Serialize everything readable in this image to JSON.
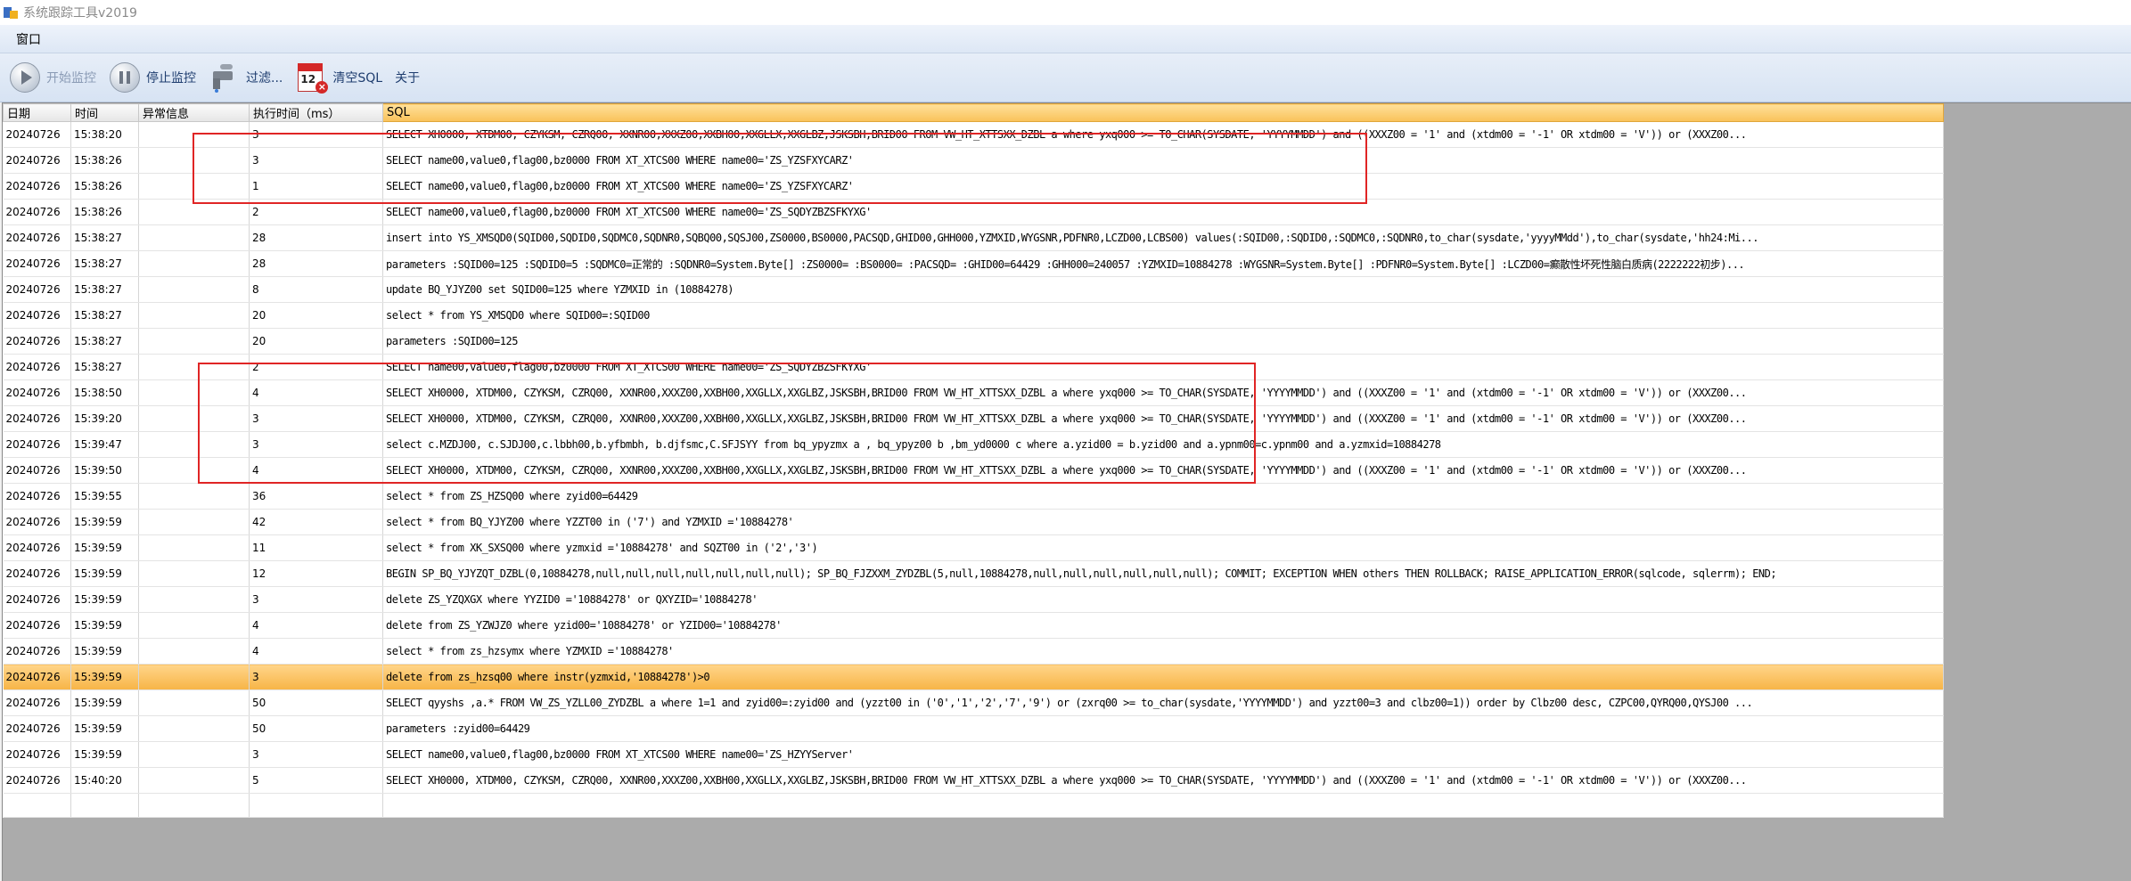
{
  "window": {
    "title": "系统跟踪工具v2019"
  },
  "menu": {
    "items": [
      "窗口"
    ]
  },
  "toolbar": {
    "start": "开始监控",
    "stop": "停止监控",
    "filter": "过滤...",
    "clear_sql": "清空SQL",
    "about": "关于"
  },
  "columns": [
    "日期",
    "时间",
    "异常信息",
    "执行时间（ms）",
    "SQL"
  ],
  "rows": [
    {
      "date": "20240726",
      "time": "15:38:20",
      "error": "",
      "ms": "3",
      "sql": "SELECT XH0000, XTDM00, CZYKSM, CZRQ00, XXNR00,XXXZ00,XXBH00,XXGLLX,XXGLBZ,JSKSBH,BRID00   FROM VW_HT_XTTSXX_DZBL a where yxq000 >= TO_CHAR(SYSDATE, 'YYYYMMDD')   and ((XXXZ00 = '1' and (xtdm00 = '-1' OR xtdm00 = 'V')) or (XXXZ00..."
    },
    {
      "date": "20240726",
      "time": "15:38:26",
      "error": "",
      "ms": "3",
      "sql": "SELECT name00,value0,flag00,bz0000 FROM XT_XTCS00 WHERE name00='ZS_YZSFXYCARZ'"
    },
    {
      "date": "20240726",
      "time": "15:38:26",
      "error": "",
      "ms": "1",
      "sql": "SELECT name00,value0,flag00,bz0000 FROM XT_XTCS00 WHERE name00='ZS_YZSFXYCARZ'"
    },
    {
      "date": "20240726",
      "time": "15:38:26",
      "error": "",
      "ms": "2",
      "sql": "SELECT name00,value0,flag00,bz0000 FROM XT_XTCS00 WHERE name00='ZS_SQDYZBZSFKYXG'"
    },
    {
      "date": "20240726",
      "time": "15:38:27",
      "error": "",
      "ms": "28",
      "sql": "insert into YS_XMSQD0(SQID00,SQDID0,SQDMC0,SQDNR0,SQBQ00,SQSJ00,ZS0000,BS0000,PACSQD,GHID00,GHH000,YZMXID,WYGSNR,PDFNR0,LCZD00,LCBS00) values(:SQID00,:SQDID0,:SQDMC0,:SQDNR0,to_char(sysdate,'yyyyMMdd'),to_char(sysdate,'hh24:Mi..."
    },
    {
      "date": "20240726",
      "time": "15:38:27",
      "error": "",
      "ms": "28",
      "sql": "parameters :SQID00=125 :SQDID0=5 :SQDMC0=正常的 :SQDNR0=System.Byte[] :ZS0000= :BS0000= :PACSQD= :GHID00=64429 :GHH000=240057 :YZMXID=10884278 :WYGSNR=System.Byte[] :PDFNR0=System.Byte[] :LCZD00=癫散性坏死性脑白质病(2222222初步)..."
    },
    {
      "date": "20240726",
      "time": "15:38:27",
      "error": "",
      "ms": "8",
      "sql": "update BQ_YJYZ00 set SQID00=125 where  YZMXID in (10884278)"
    },
    {
      "date": "20240726",
      "time": "15:38:27",
      "error": "",
      "ms": "20",
      "sql": "select * from YS_XMSQD0 where SQID00=:SQID00"
    },
    {
      "date": "20240726",
      "time": "15:38:27",
      "error": "",
      "ms": "20",
      "sql": "parameters :SQID00=125"
    },
    {
      "date": "20240726",
      "time": "15:38:27",
      "error": "",
      "ms": "2",
      "sql": "SELECT name00,value0,flag00,bz0000 FROM XT_XTCS00 WHERE name00='ZS_SQDYZBZSFKYXG'"
    },
    {
      "date": "20240726",
      "time": "15:38:50",
      "error": "",
      "ms": "4",
      "sql": "SELECT XH0000, XTDM00, CZYKSM, CZRQ00, XXNR00,XXXZ00,XXBH00,XXGLLX,XXGLBZ,JSKSBH,BRID00   FROM VW_HT_XTTSXX_DZBL a where yxq000 >= TO_CHAR(SYSDATE, 'YYYYMMDD')   and ((XXXZ00 = '1' and (xtdm00 = '-1' OR xtdm00 = 'V')) or (XXXZ00..."
    },
    {
      "date": "20240726",
      "time": "15:39:20",
      "error": "",
      "ms": "3",
      "sql": "SELECT XH0000, XTDM00, CZYKSM, CZRQ00, XXNR00,XXXZ00,XXBH00,XXGLLX,XXGLBZ,JSKSBH,BRID00   FROM VW_HT_XTTSXX_DZBL a where yxq000 >= TO_CHAR(SYSDATE, 'YYYYMMDD')   and ((XXXZ00 = '1' and (xtdm00 = '-1' OR xtdm00 = 'V')) or (XXXZ00..."
    },
    {
      "date": "20240726",
      "time": "15:39:47",
      "error": "",
      "ms": "3",
      "sql": "select  c.MZDJ00, c.SJDJ00,c.lbbh00,b.yfbmbh, b.djfsmc,C.SFJSYY from bq_ypyzmx a , bq_ypyz00 b ,bm_yd0000 c  where  a.yzid00 = b.yzid00 and a.ypnm00=c.ypnm00 and a.yzmxid=10884278"
    },
    {
      "date": "20240726",
      "time": "15:39:50",
      "error": "",
      "ms": "4",
      "sql": "SELECT XH0000, XTDM00, CZYKSM, CZRQ00, XXNR00,XXXZ00,XXBH00,XXGLLX,XXGLBZ,JSKSBH,BRID00   FROM VW_HT_XTTSXX_DZBL a where yxq000 >= TO_CHAR(SYSDATE, 'YYYYMMDD')   and ((XXXZ00 = '1' and (xtdm00 = '-1' OR xtdm00 = 'V')) or (XXXZ00..."
    },
    {
      "date": "20240726",
      "time": "15:39:55",
      "error": "",
      "ms": "36",
      "sql": "select * from ZS_HZSQ00 where zyid00=64429"
    },
    {
      "date": "20240726",
      "time": "15:39:59",
      "error": "",
      "ms": "42",
      "sql": "select * from BQ_YJYZ00 where YZZT00 in ('7') and YZMXID ='10884278'"
    },
    {
      "date": "20240726",
      "time": "15:39:59",
      "error": "",
      "ms": "11",
      "sql": " select * from XK_SXSQ00 where yzmxid ='10884278' and SQZT00 in ('2','3')"
    },
    {
      "date": "20240726",
      "time": "15:39:59",
      "error": "",
      "ms": "12",
      "sql": "BEGIN SP_BQ_YJYZQT_DZBL(0,10884278,null,null,null,null,null,null,null); SP_BQ_FJZXXM_ZYDZBL(5,null,10884278,null,null,null,null,null,null); COMMIT; EXCEPTION WHEN others THEN ROLLBACK; RAISE_APPLICATION_ERROR(sqlcode, sqlerrm); END;"
    },
    {
      "date": "20240726",
      "time": "15:39:59",
      "error": "",
      "ms": "3",
      "sql": "delete ZS_YZQXGX where YYZID0 ='10884278' or QXYZID='10884278'"
    },
    {
      "date": "20240726",
      "time": "15:39:59",
      "error": "",
      "ms": "4",
      "sql": "delete from ZS_YZWJZ0 where yzid00='10884278' or YZID00='10884278'"
    },
    {
      "date": "20240726",
      "time": "15:39:59",
      "error": "",
      "ms": "4",
      "sql": "select * from zs_hzsymx where  YZMXID ='10884278'"
    },
    {
      "date": "20240726",
      "time": "15:39:59",
      "error": "",
      "ms": "3",
      "sql": "delete from zs_hzsq00 where  instr(yzmxid,'10884278')>0",
      "selected": true
    },
    {
      "date": "20240726",
      "time": "15:39:59",
      "error": "",
      "ms": "50",
      "sql": "SELECT qyyshs ,a.* FROM VW_ZS_YZLL00_ZYDZBL a  where 1=1 and zyid00=:zyid00 and (yzzt00 in ('0','1','2','7','9') or (zxrq00 >= to_char(sysdate,'YYYYMMDD') and yzzt00=3 and clbz00=1))  order by Clbz00 desc, CZPC00,QYRQ00,QYSJ00 ..."
    },
    {
      "date": "20240726",
      "time": "15:39:59",
      "error": "",
      "ms": "50",
      "sql": "parameters :zyid00=64429"
    },
    {
      "date": "20240726",
      "time": "15:39:59",
      "error": "",
      "ms": "3",
      "sql": "SELECT name00,value0,flag00,bz0000 FROM XT_XTCS00 WHERE name00='ZS_HZYYServer'"
    },
    {
      "date": "20240726",
      "time": "15:40:20",
      "error": "",
      "ms": "5",
      "sql": "SELECT XH0000, XTDM00, CZYKSM, CZRQ00, XXNR00,XXXZ00,XXBH00,XXGLLX,XXGLBZ,JSKSBH,BRID00   FROM VW_HT_XTTSXX_DZBL a where yxq000 >= TO_CHAR(SYSDATE, 'YYYYMMDD')   and ((XXXZ00 = '1' and (xtdm00 = '-1' OR xtdm00 = 'V')) or (XXXZ00..."
    }
  ],
  "colors": {
    "highlight_border": "#e02525",
    "selected_row": "#f7b446",
    "sql_header": "#f9c25a"
  }
}
